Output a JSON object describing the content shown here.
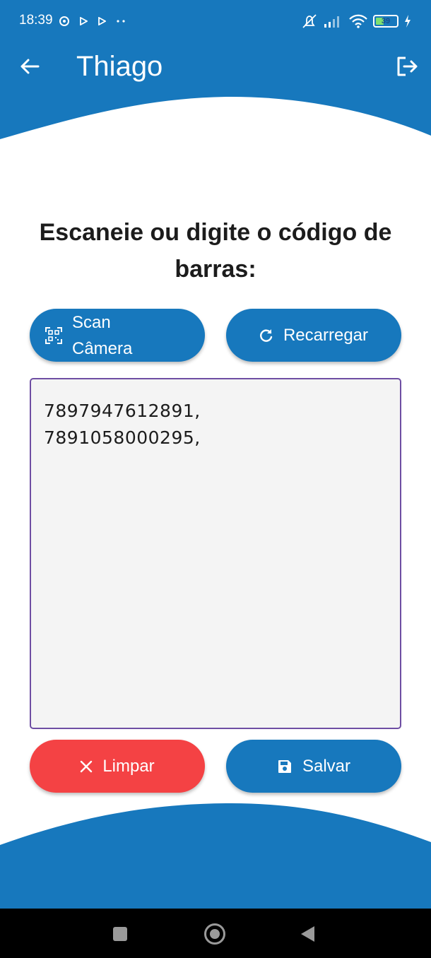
{
  "colors": {
    "primary": "#1778bd",
    "danger": "#f44244",
    "text_dark": "#1c1c1c",
    "field_border": "#6e4ea3",
    "field_bg": "#f4f4f4"
  },
  "status_bar": {
    "time": "18:39",
    "battery_level": "39",
    "battery_fraction": 0.39,
    "left_icons": [
      "chrome-icon",
      "play-icon",
      "play-icon",
      "more-dots-icon"
    ],
    "right_icons": [
      "mute-vibrate-icon",
      "signal-icon",
      "wifi-icon",
      "battery-icon",
      "charging-icon"
    ]
  },
  "app_bar": {
    "title": "Thiago",
    "back_icon": "arrow-left-icon",
    "logout_icon": "logout-icon"
  },
  "main": {
    "instruction": "Escaneie ou digite o código de barras:",
    "scan_button": {
      "line1": "Scan",
      "line2": "Câmera",
      "icon": "qr-scan-icon"
    },
    "reload_button": {
      "label": "Recarregar",
      "icon": "refresh-icon"
    },
    "codes_field": {
      "value": "7897947612891,\n7891058000295,"
    },
    "clear_button": {
      "label": "Limpar",
      "icon": "close-icon"
    },
    "save_button": {
      "label": "Salvar",
      "icon": "save-icon"
    }
  },
  "nav_bar": {
    "items": [
      "recents-square-icon",
      "home-circle-icon",
      "back-triangle-icon"
    ]
  }
}
